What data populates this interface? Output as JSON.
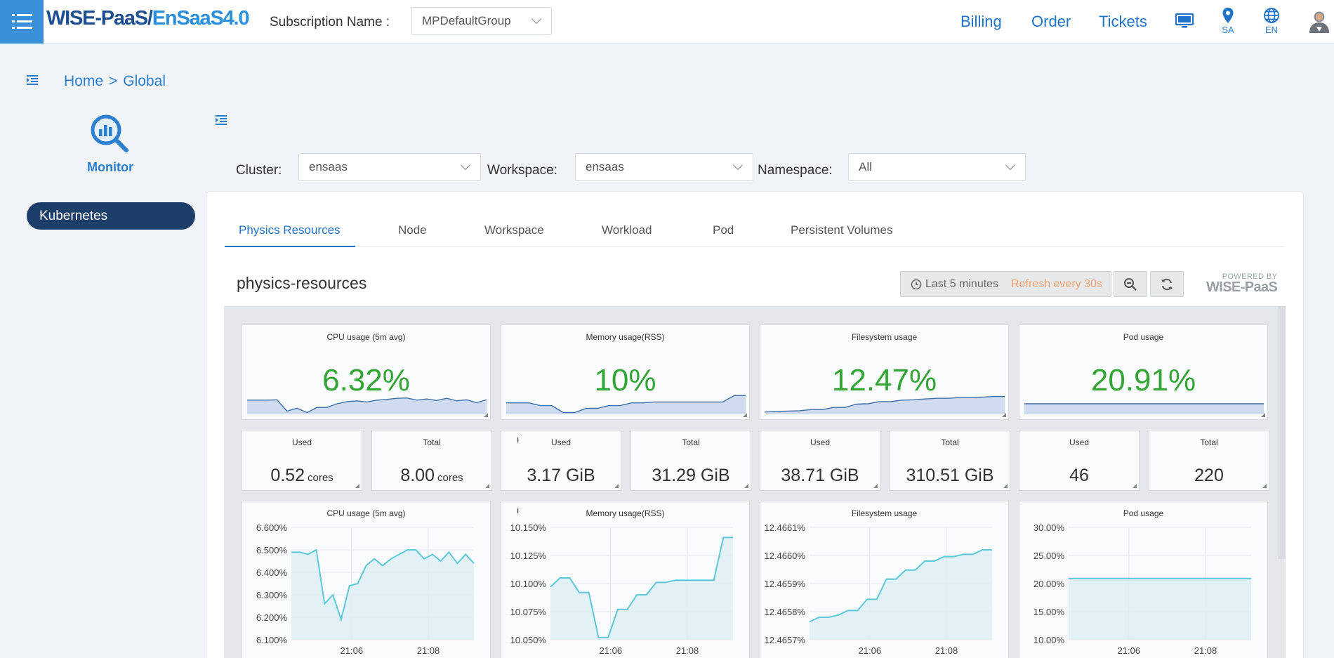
{
  "header": {
    "brand_part1": "WISE-PaaS/",
    "brand_part2": "EnSaaS4.0",
    "subscription_label": "Subscription Name :",
    "subscription_value": "MPDefaultGroup",
    "links": {
      "billing": "Billing",
      "order": "Order",
      "tickets": "Tickets"
    },
    "icons": {
      "desktop": "desktop-icon",
      "location": "map-pin-icon",
      "language": "globe-icon",
      "user": "user-avatar-icon"
    },
    "location_label": "SA",
    "language_label": "EN"
  },
  "breadcrumb": {
    "home": "Home",
    "separator": ">",
    "current": "Global"
  },
  "sidebar": {
    "app_label": "Monitor",
    "items": [
      {
        "label": "Kubernetes"
      }
    ]
  },
  "filters": {
    "cluster_label": "Cluster:",
    "cluster_value": "ensaas",
    "workspace_label": "Workspace:",
    "workspace_value": "ensaas",
    "namespace_label": "Namespace:",
    "namespace_value": "All"
  },
  "tabs": [
    {
      "label": "Physics Resources",
      "active": true
    },
    {
      "label": "Node"
    },
    {
      "label": "Workspace"
    },
    {
      "label": "Workload"
    },
    {
      "label": "Pod"
    },
    {
      "label": "Persistent Volumes"
    }
  ],
  "dashboard": {
    "title": "physics-resources",
    "time_range": "Last 5 minutes",
    "refresh": "Refresh every 30s",
    "powered_line1": "POWERED BY",
    "powered_line2": "WISE-PaaS"
  },
  "gauges": [
    {
      "title": "CPU usage (5m avg)",
      "value": "6.32%",
      "spark": [
        0.7,
        0.7,
        0.7,
        0.72,
        0.1,
        0.26,
        0.02,
        0.3,
        0.3,
        0.5,
        0.62,
        0.66,
        0.6,
        0.7,
        0.74,
        0.8,
        0.82,
        0.7,
        0.76,
        0.68,
        0.8,
        0.66,
        0.72,
        0.56,
        0.72
      ]
    },
    {
      "title": "Memory usage(RSS)",
      "value": "10%",
      "spark": [
        0.55,
        0.55,
        0.55,
        0.4,
        0.4,
        0.02,
        0.02,
        0.25,
        0.25,
        0.4,
        0.4,
        0.55,
        0.55,
        0.6,
        0.6,
        0.6,
        0.6,
        0.6,
        0.6,
        0.6,
        0.95,
        0.95
      ]
    },
    {
      "title": "Filesystem usage",
      "value": "12.47%",
      "spark": [
        0.05,
        0.08,
        0.1,
        0.12,
        0.18,
        0.18,
        0.3,
        0.3,
        0.48,
        0.5,
        0.62,
        0.62,
        0.7,
        0.72,
        0.76,
        0.8,
        0.8,
        0.84,
        0.84,
        0.86,
        0.9,
        0.9
      ]
    },
    {
      "title": "Pod usage",
      "value": "20.91%",
      "spark": [
        0.5,
        0.5,
        0.5,
        0.5,
        0.5,
        0.5,
        0.5,
        0.5,
        0.5,
        0.5,
        0.5,
        0.5,
        0.5,
        0.5,
        0.5
      ]
    }
  ],
  "stats": [
    {
      "title": "Used",
      "value": "0.52",
      "unit": "cores"
    },
    {
      "title": "Total",
      "value": "8.00",
      "unit": "cores"
    },
    {
      "title": "Used",
      "value": "3.17 GiB",
      "unit": "",
      "info": "i"
    },
    {
      "title": "Total",
      "value": "31.29 GiB",
      "unit": ""
    },
    {
      "title": "Used",
      "value": "38.71 GiB",
      "unit": ""
    },
    {
      "title": "Total",
      "value": "310.51 GiB",
      "unit": ""
    },
    {
      "title": "Used",
      "value": "46",
      "unit": ""
    },
    {
      "title": "Total",
      "value": "220",
      "unit": ""
    }
  ],
  "chart_data": [
    {
      "type": "area",
      "title": "CPU usage (5m avg)",
      "yticks": [
        "6.600%",
        "6.500%",
        "6.400%",
        "6.300%",
        "6.200%",
        "6.100%"
      ],
      "xticks": [
        "21:06",
        "21:08"
      ],
      "ylim": [
        6.1,
        6.6
      ],
      "values": [
        6.49,
        6.49,
        6.48,
        6.5,
        6.26,
        6.3,
        6.19,
        6.34,
        6.35,
        6.43,
        6.46,
        6.43,
        6.46,
        6.48,
        6.5,
        6.5,
        6.46,
        6.48,
        6.45,
        6.49,
        6.44,
        6.48,
        6.44
      ]
    },
    {
      "type": "area",
      "title": "Memory usage(RSS)",
      "info": "i",
      "yticks": [
        "10.150%",
        "10.125%",
        "10.100%",
        "10.075%",
        "10.050%"
      ],
      "xticks": [
        "21:06",
        "21:08"
      ],
      "ylim": [
        10.05,
        10.15
      ],
      "values": [
        10.097,
        10.105,
        10.105,
        10.092,
        10.092,
        10.052,
        10.052,
        10.077,
        10.077,
        10.09,
        10.09,
        10.101,
        10.101,
        10.103,
        10.103,
        10.103,
        10.103,
        10.103,
        10.141,
        10.141
      ]
    },
    {
      "type": "area",
      "title": "Filesystem usage",
      "yticks": [
        "12.4661%",
        "12.4660%",
        "12.4659%",
        "12.4658%",
        "12.4657%"
      ],
      "xticks": [
        "21:06",
        "21:08"
      ],
      "ylim": [
        12.46565,
        12.46615
      ],
      "values": [
        12.46573,
        12.46575,
        12.46575,
        12.46576,
        12.46578,
        12.46578,
        12.46583,
        12.46583,
        12.46592,
        12.46592,
        12.46596,
        12.46596,
        12.466,
        12.466,
        12.46602,
        12.46602,
        12.46603,
        12.46603,
        12.46605,
        12.46605
      ]
    },
    {
      "type": "area",
      "title": "Pod usage",
      "yticks": [
        "30.00%",
        "25.00%",
        "20.00%",
        "15.00%",
        "10.00%"
      ],
      "xticks": [
        "21:06",
        "21:08"
      ],
      "ylim": [
        10,
        30
      ],
      "values": [
        20.91,
        20.91,
        20.91,
        20.91,
        20.91,
        20.91,
        20.91,
        20.91,
        20.91,
        20.91
      ]
    }
  ],
  "colors": {
    "accent": "#1f74c9",
    "gauge_value": "#33a534",
    "series_line": "#5bc9d8",
    "series_fill": "#dceff3",
    "sidebar_active": "#1e3e6a"
  }
}
